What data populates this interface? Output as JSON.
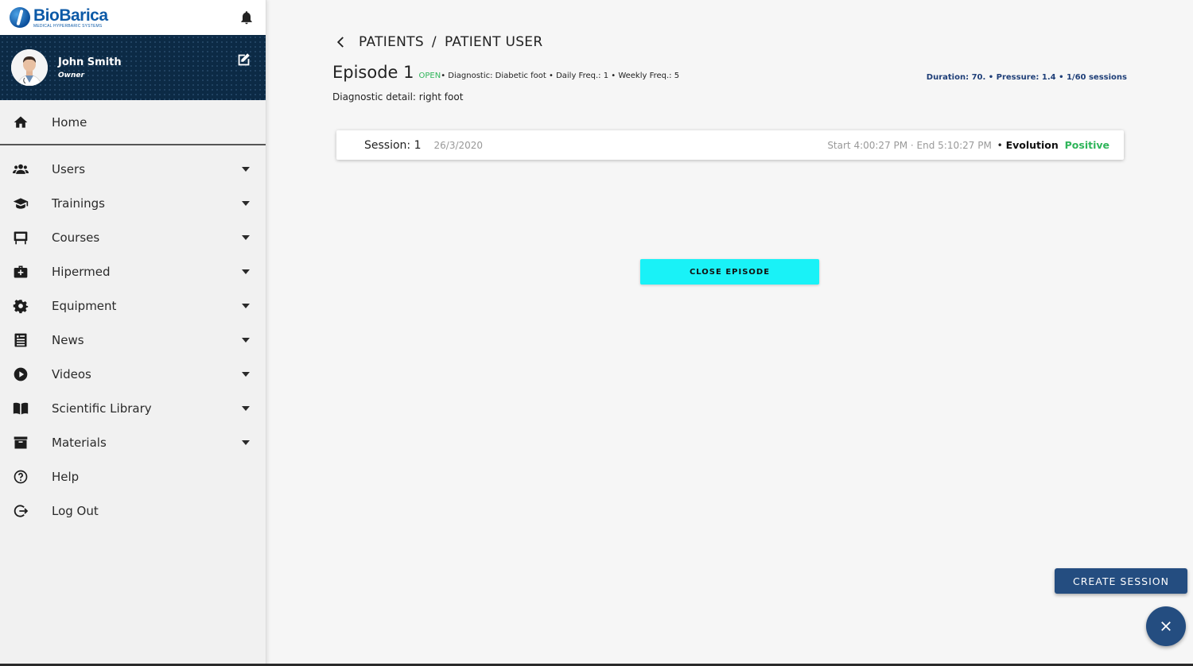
{
  "brand": {
    "name": "BioBarica",
    "tagline": "MEDICAL HYPERBARIC SYSTEMS"
  },
  "user": {
    "name": "John Smith",
    "role": "Owner"
  },
  "sidebar": {
    "items": [
      {
        "label": "Home",
        "icon": "home-icon"
      },
      {
        "label": "Users",
        "icon": "users-icon"
      },
      {
        "label": "Trainings",
        "icon": "graduation-cap-icon"
      },
      {
        "label": "Courses",
        "icon": "chalkboard-icon"
      },
      {
        "label": "Hipermed",
        "icon": "medkit-icon"
      },
      {
        "label": "Equipment",
        "icon": "gear-icon"
      },
      {
        "label": "News",
        "icon": "newspaper-icon"
      },
      {
        "label": "Videos",
        "icon": "play-circle-icon"
      },
      {
        "label": "Scientific Library",
        "icon": "book-icon"
      },
      {
        "label": "Materials",
        "icon": "archive-icon"
      },
      {
        "label": "Help",
        "icon": "help-circle-icon"
      },
      {
        "label": "Log Out",
        "icon": "logout-icon"
      }
    ]
  },
  "breadcrumb": {
    "parent": "PATIENTS",
    "separator": "/",
    "current": "PATIENT USER"
  },
  "episode": {
    "title": "Episode 1",
    "status": "OPEN",
    "meta": " • Diagnostic: Diabetic foot • Daily Freq.: 1 • Weekly Freq.: 5",
    "summary": "Duration: 70. • Pressure: 1.4 • 1/60 sessions",
    "diagnostic_detail": "Diagnostic detail: right foot"
  },
  "sessions": [
    {
      "label": "Session: 1",
      "date": "26/3/2020",
      "times": "Start 4:00:27 PM · End 5:10:27 PM",
      "bullet": "•",
      "evolution_label": "Evolution",
      "evolution_value": "Positive"
    }
  ],
  "actions": {
    "close_episode": "CLOSE EPISODE",
    "create_session": "CREATE SESSION"
  },
  "colors": {
    "accent": "#19f2f7",
    "primary": "#244d80",
    "positive": "#2fb55a",
    "sidebar_header": "#0c2a45"
  }
}
